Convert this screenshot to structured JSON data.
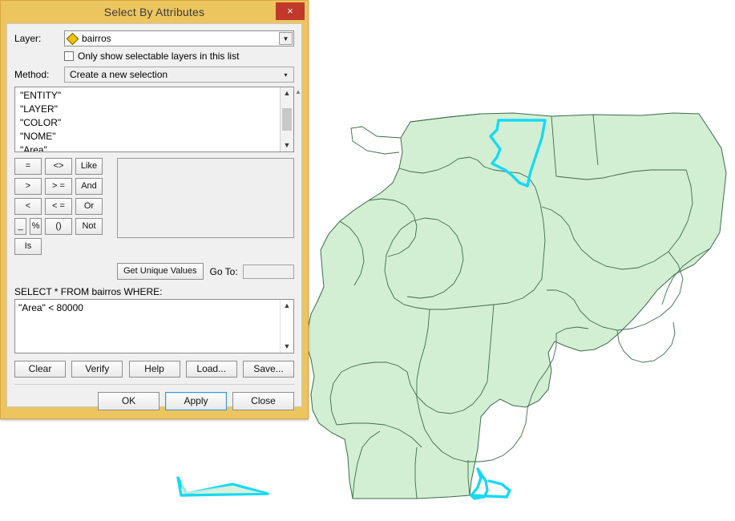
{
  "dialog": {
    "title": "Select By Attributes",
    "close_icon": "close-icon",
    "close_label": "×",
    "layer": {
      "label": "Layer:",
      "value": "bairros",
      "icon": "layer-diamond-icon",
      "dropdown_icon": "chevron-down-icon",
      "checkbox_label": "Only show selectable layers in this list",
      "checkbox_checked": false
    },
    "method": {
      "label": "Method:",
      "value": "Create a new selection",
      "dropdown_icon": "chevron-down-icon"
    },
    "fields": {
      "items": [
        {
          "name": "\"ENTITY\"",
          "selected": false
        },
        {
          "name": "\"LAYER\"",
          "selected": false
        },
        {
          "name": "\"COLOR\"",
          "selected": false
        },
        {
          "name": "\"NOME\"",
          "selected": false
        },
        {
          "name": "\"Area\"",
          "selected": true
        }
      ],
      "scroll_up_icon": "chevron-up-icon",
      "scroll_down_icon": "chevron-down-icon"
    },
    "operators": [
      [
        "=",
        "<>",
        "Like"
      ],
      [
        ">",
        "> =",
        "And"
      ],
      [
        "<",
        "< =",
        "Or"
      ],
      [
        "_",
        "%",
        "()",
        "Not"
      ],
      [
        "Is"
      ]
    ],
    "unique_values": {
      "button_label": "Get Unique Values",
      "goto_label": "Go To:",
      "goto_value": "",
      "list_values": []
    },
    "sql": {
      "label": "SELECT * FROM bairros WHERE:",
      "query": "\"Area\" < 80000",
      "scroll_up_icon": "chevron-up-icon",
      "scroll_down_icon": "chevron-down-icon"
    },
    "tool_buttons": [
      "Clear",
      "Verify",
      "Help",
      "Load...",
      "Save..."
    ],
    "action_buttons": [
      {
        "label": "OK",
        "focused": false
      },
      {
        "label": "Apply",
        "focused": true
      },
      {
        "label": "Close",
        "focused": false
      }
    ]
  },
  "map": {
    "background": "#ffffff",
    "polygon_fill": "#d2efd4",
    "polygon_stroke": "#3d6b4a",
    "selection_stroke": "#17d9f5",
    "selected_count": 3
  },
  "colors": {
    "title_bar": "#edc55f",
    "close_button": "#c0392b",
    "dialog_body": "#f0f0f0",
    "focus_border": "#3e93d8",
    "map_fill": "#d2efd4",
    "map_outline": "#3d6b4a",
    "selection_cyan": "#17d9f5"
  }
}
